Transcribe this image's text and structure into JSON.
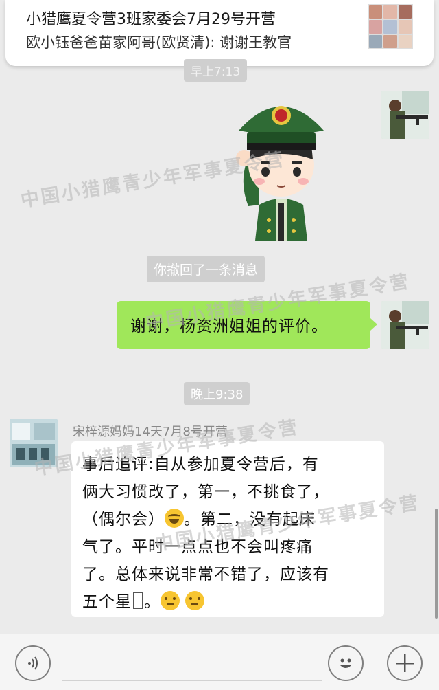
{
  "notification": {
    "title": "小猎鹰夏令营3班家委会7月29号开营",
    "message": "欧小钰爸爸苗家阿哥(欧贤清): 谢谢王教官",
    "partial_time": "早上7:13"
  },
  "chat": {
    "recalled_notice": "你撤回了一条消息",
    "sent_message": "谢谢，杨资洲姐姐的评价。",
    "timestamp": "晚上9:38",
    "sender_name": "宋梓源妈妈14天7月8号开营",
    "received_lines": [
      "事后追评:自从参加夏令营后，有",
      "俩大习惯改了，第一，不挑食了，",
      "（偶尔会）",
      "。第二，没有起床",
      "气了。平时一点点也不会叫疼痛",
      "了。总体来说非常不错了，应该有",
      "五个星"
    ],
    "watermark_text": "中国小猎鹰青少年军事夏令营"
  },
  "icons": {
    "voice": "voice-icon",
    "emoji": "emoji-icon",
    "plus": "plus-icon",
    "emoji_laugh": "laughing-tears-emoji",
    "emoji_think": "thinking-emoji"
  },
  "colors": {
    "chat_background": "#ebebeb",
    "sent_bubble": "#a0e75a",
    "received_bubble": "#ffffff",
    "pill": "#cfcfcf"
  }
}
